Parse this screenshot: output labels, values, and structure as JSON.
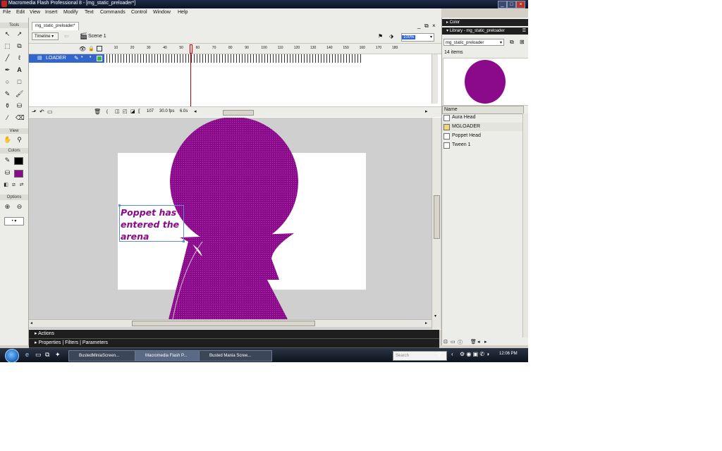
{
  "app": {
    "title": "Macromedia Flash Professional 8 - [mg_static_preloader*]",
    "window_buttons": [
      "_",
      "□",
      "×"
    ]
  },
  "menu": [
    "File",
    "Edit",
    "View",
    "Insert",
    "Modify",
    "Text",
    "Commands",
    "Control",
    "Window",
    "Help"
  ],
  "tools": {
    "title": "Tools",
    "view_label": "View",
    "colors_label": "Colors",
    "options_label": "Options",
    "stroke_color": "#000000",
    "fill_color": "#8b0a8b"
  },
  "document": {
    "tab": "mg_static_preloader*",
    "timeline_button": "Timeline",
    "scene": "Scene 1",
    "zoom": "100%",
    "doc_buttons": [
      "_",
      " ̆",
      "×"
    ],
    "frame_numbers": [
      "5",
      "10",
      "15",
      "20",
      "25",
      "30",
      "35",
      "40",
      "45",
      "50",
      "55",
      "60",
      "65",
      "70",
      "75",
      "80",
      "85",
      "90",
      "95",
      "100",
      "105",
      "110",
      "115",
      "120",
      "125",
      "130",
      "135",
      "140",
      "145",
      "150",
      "155",
      "160",
      "165",
      "170",
      "175",
      "180",
      "18"
    ],
    "layer_name": "LOADER",
    "current_frame": "107",
    "fps": "30.0 fps",
    "elapsed": "6.0s",
    "stage_text": "Poppet has entered the arena",
    "shape_color": "#8b0a8b"
  },
  "panels": {
    "actions": "Actions",
    "properties_tabs": [
      "Properties",
      "Filters",
      "Parameters"
    ]
  },
  "right": {
    "color_panel": "Color",
    "library_panel": "Library - mg_static_preloader",
    "library_select": "mg_static_preloader",
    "item_count": "14 items",
    "name_column": "Name",
    "items": [
      "Aura Head",
      "MGLOADER",
      "Poppet Head",
      "Tween 1"
    ]
  },
  "taskbar": {
    "buttons": [
      "BustedMiniaScreen...",
      "Macromedia Flash P...",
      "Busted Mania Scree..."
    ],
    "search_placeholder": "Search",
    "clock": "12:06 PM"
  }
}
